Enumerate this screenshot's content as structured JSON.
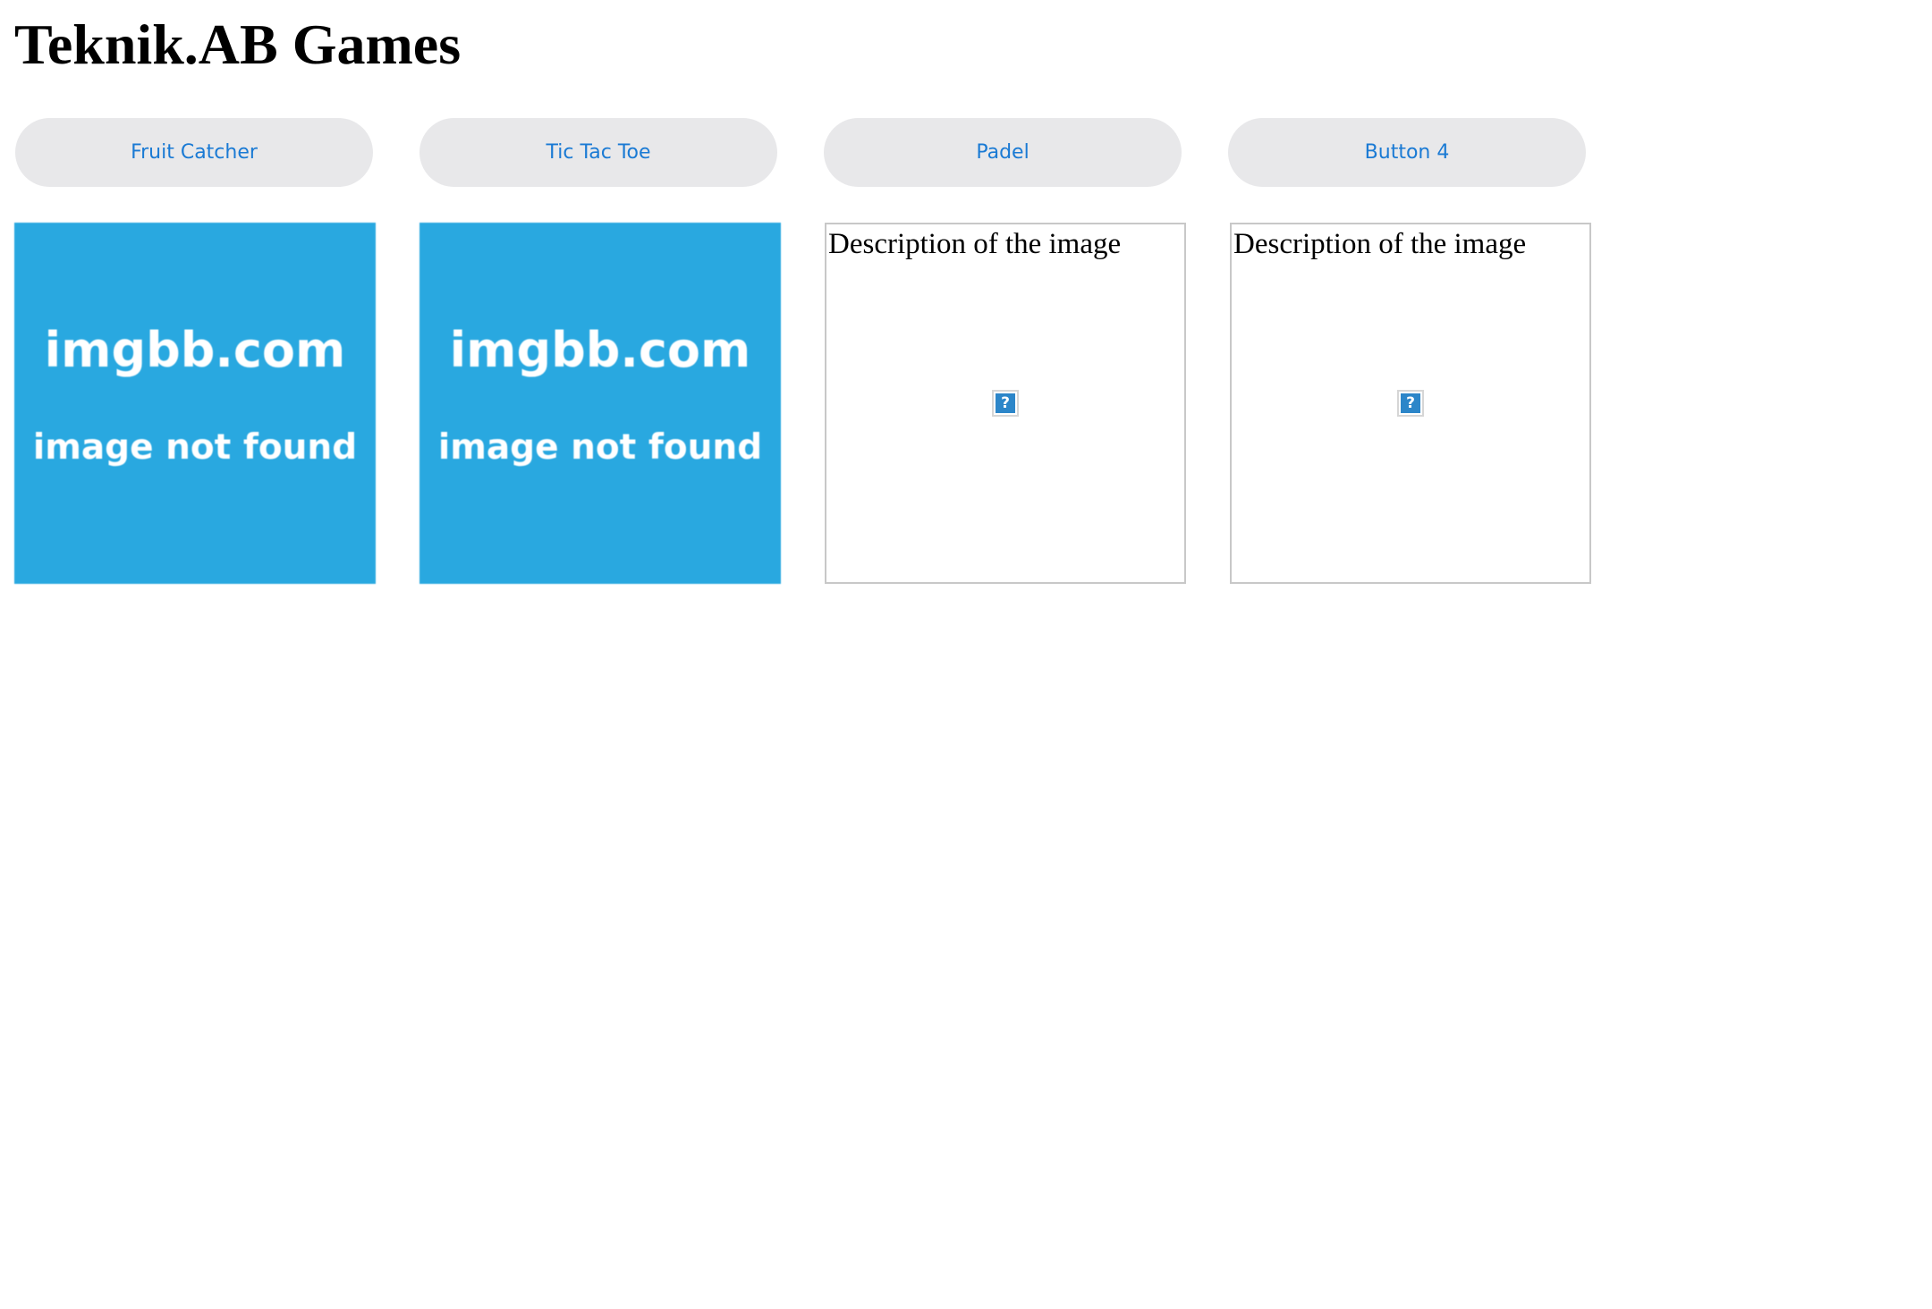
{
  "page": {
    "title": "Teknik.AB Games"
  },
  "buttons": [
    {
      "label": "Fruit Catcher"
    },
    {
      "label": "Tic Tac Toe"
    },
    {
      "label": "Padel"
    },
    {
      "label": "Button 4"
    }
  ],
  "images": [
    {
      "state": "placeholder",
      "line1": "imgbb.com",
      "line2": "image not found"
    },
    {
      "state": "placeholder",
      "line1": "imgbb.com",
      "line2": "image not found"
    },
    {
      "state": "broken",
      "alt": "Description of the image",
      "icon": "broken-image-icon",
      "icon_glyph": "?"
    },
    {
      "state": "broken",
      "alt": "Description of the image",
      "icon": "broken-image-icon",
      "icon_glyph": "?"
    }
  ],
  "colors": {
    "button_bg": "#e8e8ea",
    "button_text": "#1a7ad4",
    "placeholder_bg": "#29a8e0",
    "broken_border": "#c8c8c8"
  }
}
